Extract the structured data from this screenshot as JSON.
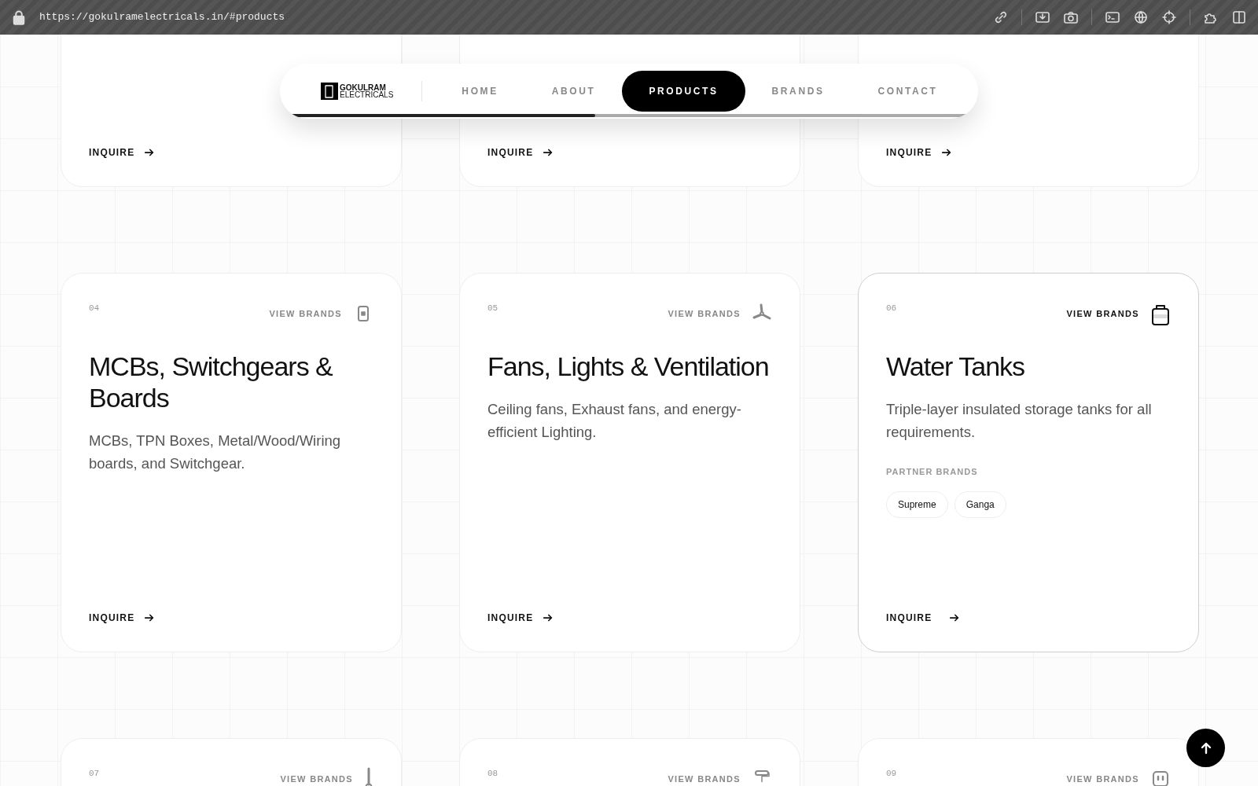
{
  "browser": {
    "url": "https://gokulramelectricals.in/#products"
  },
  "nav": {
    "logo": {
      "line1": "GOKULRAM",
      "line2": "ELECTRICALS"
    },
    "items": [
      {
        "label": "HOME",
        "selected": false
      },
      {
        "label": "ABOUT",
        "selected": false
      },
      {
        "label": "PRODUCTS",
        "selected": true
      },
      {
        "label": "BRANDS",
        "selected": false
      },
      {
        "label": "CONTACT",
        "selected": false
      }
    ],
    "progress": {
      "level": 0.45
    }
  },
  "cards": [
    {
      "kind": "cut",
      "inquire": "INQUIRE"
    },
    {
      "kind": "cut",
      "inquire": "INQUIRE"
    },
    {
      "kind": "cut",
      "inquire": "INQUIRE"
    },
    {
      "kind": "full",
      "number": "04",
      "view_brands": "VIEW BRANDS",
      "title": "MCBs, Switchgears & Boards",
      "description": "MCBs, TPN Boxes, Metal/Wood/Wiring boards, and Switchgear.",
      "expanded": false,
      "inquire": "INQUIRE"
    },
    {
      "kind": "full",
      "number": "05",
      "view_brands": "VIEW BRANDS",
      "title": "Fans, Lights & Ventilation",
      "description": "Ceiling fans, Exhaust fans, and energy-efficient Lighting.",
      "expanded": false,
      "inquire": "INQUIRE"
    },
    {
      "kind": "full",
      "number": "06",
      "view_brands": "VIEW BRANDS",
      "title": "Water Tanks",
      "description": "Triple-layer insulated storage tanks for all requirements.",
      "expanded": true,
      "partner_label": "PARTNER BRANDS",
      "brands": [
        "Supreme",
        "Ganga"
      ],
      "inquire": "INQUIRE"
    },
    {
      "kind": "top",
      "number": "07",
      "view_brands": "VIEW BRANDS"
    },
    {
      "kind": "top",
      "number": "08",
      "view_brands": "VIEW BRANDS"
    },
    {
      "kind": "top",
      "number": "09",
      "view_brands": "VIEW BRANDS"
    }
  ]
}
